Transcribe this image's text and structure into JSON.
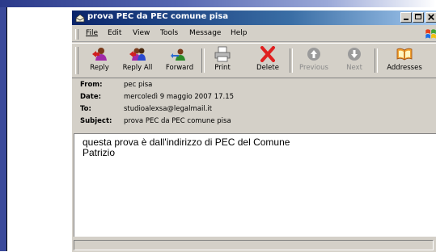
{
  "window": {
    "title": "prova PEC da PEC comune pisa"
  },
  "menu": {
    "items": [
      {
        "key": "file",
        "label": "File"
      },
      {
        "key": "edit",
        "label": "Edit"
      },
      {
        "key": "view",
        "label": "View"
      },
      {
        "key": "tools",
        "label": "Tools"
      },
      {
        "key": "message",
        "label": "Message"
      },
      {
        "key": "help",
        "label": "Help"
      }
    ]
  },
  "toolbar": {
    "reply": "Reply",
    "reply_all": "Reply All",
    "forward": "Forward",
    "print": "Print",
    "delete": "Delete",
    "previous": "Previous",
    "next": "Next",
    "addresses": "Addresses"
  },
  "header": {
    "from_label": "From:",
    "from_value": "pec pisa",
    "date_label": "Date:",
    "date_value": "mercoledì 9 maggio 2007 17.15",
    "to_label": "To:",
    "to_value": "studioalexsa@legalmail.it",
    "subject_label": "Subject:",
    "subject_value": "prova PEC da PEC comune pisa"
  },
  "body": {
    "text": "questa prova è dall'indirizzo di PEC del Comune\nPatrizio"
  },
  "colors": {
    "titlebar": "#0a246a",
    "window_face": "#d4d0c8",
    "delete_icon": "#e02020",
    "slide_accent": "#3b4a9a"
  },
  "icons": {
    "window": "envelope-icon",
    "reply": "reply-people-icon",
    "reply_all": "reply-all-people-icon",
    "forward": "forward-people-icon",
    "print": "printer-icon",
    "delete": "red-x-icon",
    "previous": "up-arrow-circle-icon",
    "next": "down-arrow-circle-icon",
    "addresses": "address-book-icon",
    "brand": "windows-flag-icon"
  }
}
